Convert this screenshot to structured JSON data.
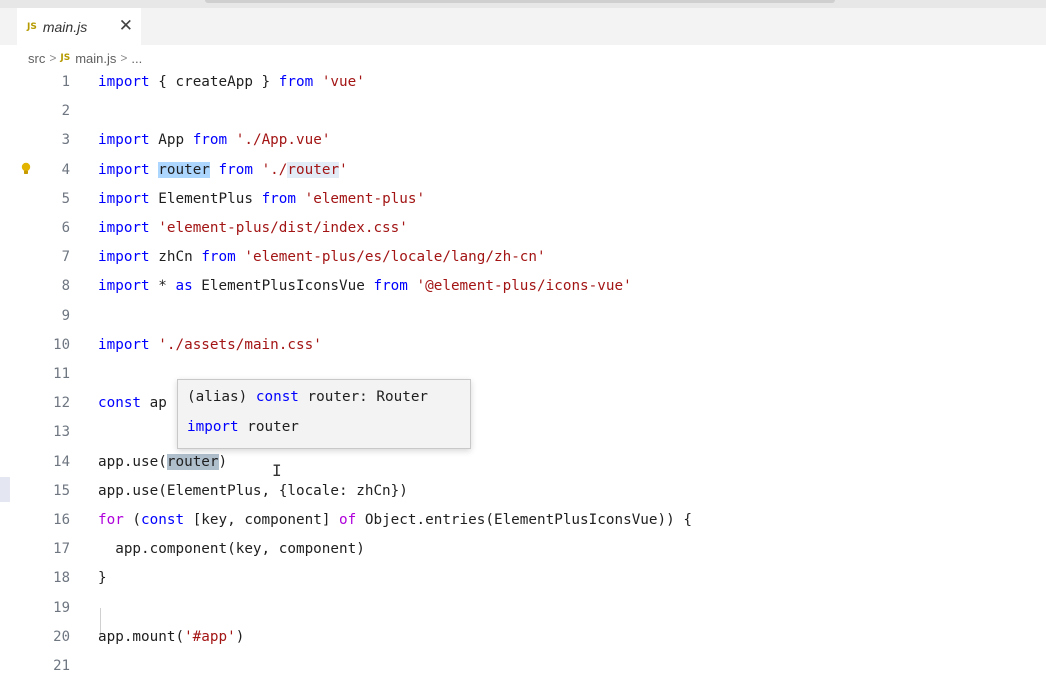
{
  "tab": {
    "badge": "JS",
    "label": "main.js",
    "close": "✕"
  },
  "breadcrumb": {
    "folder": "src",
    "sep": ">",
    "badge": "JS",
    "file": "main.js",
    "more": "..."
  },
  "lines": [
    {
      "n": "1",
      "tokens": [
        [
          "kw",
          "import"
        ],
        [
          "id",
          " { createApp } "
        ],
        [
          "kw",
          "from"
        ],
        [
          "id",
          " "
        ],
        [
          "str",
          "'vue'"
        ]
      ]
    },
    {
      "n": "2",
      "tokens": []
    },
    {
      "n": "3",
      "tokens": [
        [
          "kw",
          "import"
        ],
        [
          "id",
          " App "
        ],
        [
          "kw",
          "from"
        ],
        [
          "id",
          " "
        ],
        [
          "str",
          "'./App.vue'"
        ]
      ]
    },
    {
      "n": "4",
      "tokens": [
        [
          "kw",
          "import"
        ],
        [
          "id",
          " "
        ],
        [
          "id hl-strong",
          "router"
        ],
        [
          "id",
          " "
        ],
        [
          "kw",
          "from"
        ],
        [
          "id",
          " "
        ],
        [
          "str",
          "'./"
        ],
        [
          "str hl-soft",
          "router"
        ],
        [
          "str",
          "'"
        ]
      ]
    },
    {
      "n": "5",
      "tokens": [
        [
          "kw",
          "import"
        ],
        [
          "id",
          " ElementPlus "
        ],
        [
          "kw",
          "from"
        ],
        [
          "id",
          " "
        ],
        [
          "str",
          "'element-plus'"
        ]
      ]
    },
    {
      "n": "6",
      "tokens": [
        [
          "kw",
          "import"
        ],
        [
          "id",
          " "
        ],
        [
          "str",
          "'element-plus/dist/index.css'"
        ]
      ]
    },
    {
      "n": "7",
      "tokens": [
        [
          "kw",
          "import"
        ],
        [
          "id",
          " zhCn "
        ],
        [
          "kw",
          "from"
        ],
        [
          "id",
          " "
        ],
        [
          "str",
          "'element-plus/es/locale/lang/zh-cn'"
        ]
      ]
    },
    {
      "n": "8",
      "tokens": [
        [
          "kw",
          "import"
        ],
        [
          "id",
          " * "
        ],
        [
          "kw",
          "as"
        ],
        [
          "id",
          " ElementPlusIconsVue "
        ],
        [
          "kw",
          "from"
        ],
        [
          "id",
          " "
        ],
        [
          "str",
          "'@element-plus/icons-vue'"
        ]
      ]
    },
    {
      "n": "9",
      "tokens": []
    },
    {
      "n": "10",
      "tokens": [
        [
          "kw",
          "import"
        ],
        [
          "id",
          " "
        ],
        [
          "str",
          "'./assets/main.css'"
        ]
      ]
    },
    {
      "n": "11",
      "tokens": []
    },
    {
      "n": "12",
      "tokens": [
        [
          "kw",
          "const"
        ],
        [
          "id",
          " ap"
        ]
      ]
    },
    {
      "n": "13",
      "tokens": []
    },
    {
      "n": "14",
      "tokens": [
        [
          "id",
          "app.use("
        ],
        [
          "id hl-grey",
          "router"
        ],
        [
          "id",
          ")"
        ]
      ]
    },
    {
      "n": "15",
      "tokens": [
        [
          "id",
          "app.use(ElementPlus, {locale: zhCn})"
        ]
      ]
    },
    {
      "n": "16",
      "tokens": [
        [
          "ctl",
          "for"
        ],
        [
          "id",
          " ("
        ],
        [
          "kw",
          "const"
        ],
        [
          "id",
          " [key, component] "
        ],
        [
          "ctl",
          "of"
        ],
        [
          "id",
          " Object.entries(ElementPlusIconsVue)) {"
        ]
      ]
    },
    {
      "n": "17",
      "tokens": [
        [
          "id",
          "  app.component(key, component)"
        ]
      ]
    },
    {
      "n": "18",
      "tokens": [
        [
          "id",
          "}"
        ]
      ]
    },
    {
      "n": "19",
      "tokens": []
    },
    {
      "n": "20",
      "tokens": [
        [
          "id",
          "app.mount("
        ],
        [
          "str",
          "'#app'"
        ],
        [
          "id",
          ")"
        ]
      ]
    },
    {
      "n": "21",
      "tokens": []
    }
  ],
  "hover": {
    "line1": [
      [
        "id",
        "(alias) "
      ],
      [
        "kw",
        "const"
      ],
      [
        "id",
        " router: Router"
      ]
    ],
    "line2": [
      [
        "kw",
        "import"
      ],
      [
        "id",
        " router"
      ]
    ]
  },
  "colors": {
    "keyword": "#0000ff",
    "control": "#af00db",
    "string": "#a31515",
    "lineNumber": "#6e7681"
  },
  "icons": {
    "lightbulb": "lightbulb-icon",
    "cursor": "text-cursor-icon"
  }
}
